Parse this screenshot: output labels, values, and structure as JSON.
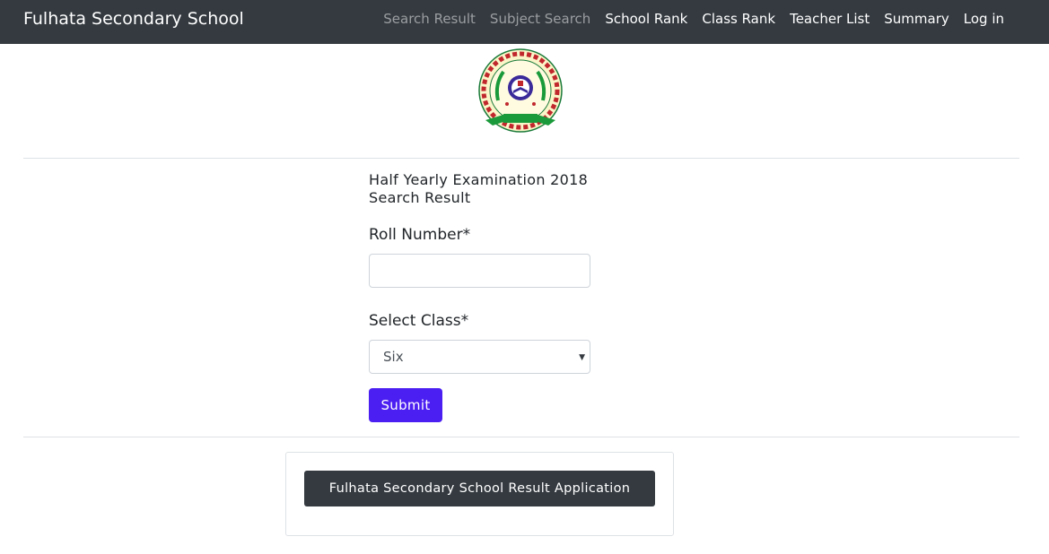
{
  "navbar": {
    "brand": "Fulhata Secondary School",
    "links": [
      {
        "label": "Search Result",
        "muted": true
      },
      {
        "label": "Subject Search",
        "muted": true
      },
      {
        "label": "School Rank",
        "muted": false
      },
      {
        "label": "Class Rank",
        "muted": false
      },
      {
        "label": "Teacher List",
        "muted": false
      },
      {
        "label": "Summary",
        "muted": false
      },
      {
        "label": "Log in",
        "muted": false
      }
    ]
  },
  "logo": {
    "icon": "school-emblem-icon"
  },
  "form": {
    "exam_title": "Half Yearly Examination 2018",
    "subtitle": "Search Result",
    "roll_label": "Roll Number*",
    "roll_value": "",
    "class_label": "Select Class*",
    "class_selected": "Six",
    "submit_label": "Submit"
  },
  "footer": {
    "app_button_label": "Fulhata Secondary School Result Application"
  },
  "colors": {
    "navbar_bg": "#343a40",
    "submit_bg": "#4b1ff2",
    "card_button_bg": "#343a40"
  }
}
